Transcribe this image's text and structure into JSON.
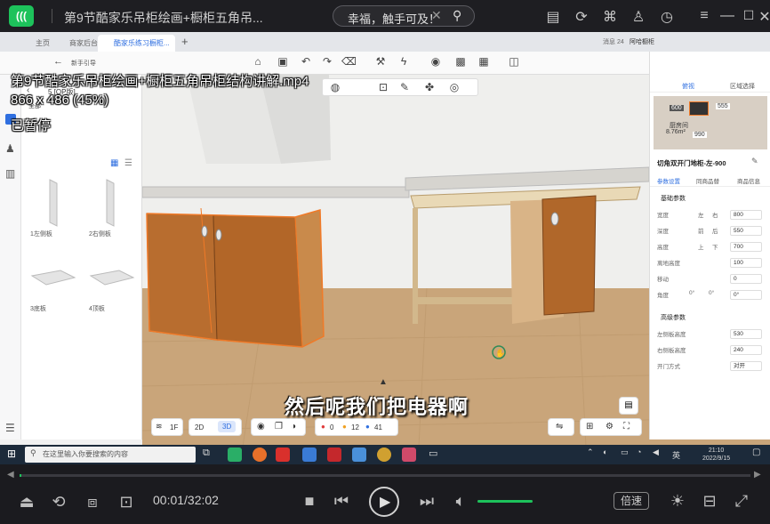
{
  "player": {
    "logo_text": "(((",
    "title": "第9节酷家乐吊柜绘画+橱柜五角吊...",
    "search_text": "幸福，触手可及！",
    "overlay_filename": "第9节酷家乐吊柜绘画+橱柜五角吊柜结构讲解.mp4",
    "overlay_resolution": "866 x 486 (45%)",
    "overlay_status": "已暂停",
    "subtitle": "然后呢我们把电器啊",
    "time": "00:01/32:02",
    "progress": 0.0005,
    "volume": 1.0,
    "speed_label": "倍速"
  },
  "browser": {
    "tabs": [
      {
        "label": "主页"
      },
      {
        "label": "商家后台"
      },
      {
        "label": "酷家乐练习橱柜..."
      }
    ],
    "new_tab": "+"
  },
  "app": {
    "back_label": "新手引导",
    "left_panel": {
      "header": "5 [OP版]",
      "rail_label": "全部",
      "parts": [
        {
          "label": "1左侧板"
        },
        {
          "label": "2右侧板"
        },
        {
          "label": "3底板"
        },
        {
          "label": "4顶板"
        }
      ]
    },
    "floating_toolbar_value": "",
    "bottom_bar": {
      "floor": "1F",
      "view_2d": "2D",
      "view_3d": "3D",
      "error_count": "0",
      "warn_count": "12",
      "info_count": "41"
    },
    "right_panel": {
      "user_msg": "消息 24",
      "user_name": "阿哈橱柜",
      "tabs": [
        "俯视",
        "区域选择"
      ],
      "minimap": {
        "left": "600",
        "right": "555",
        "center": "990",
        "room": "厨房间",
        "area": "8.76m²"
      },
      "object_title": "切角双开门地柜-左-900",
      "prop_tabs": [
        "参数设置",
        "同商品替",
        "商品信息"
      ],
      "section_basic": "基础参数",
      "rows": [
        {
          "label": "宽度",
          "opt1": "左",
          "opt2": "右",
          "value": "800"
        },
        {
          "label": "深度",
          "opt1": "前",
          "opt2": "后",
          "value": "550"
        },
        {
          "label": "高度",
          "opt1": "上",
          "opt2": "下",
          "value": "700"
        },
        {
          "label": "离地高度",
          "opt1": "",
          "opt2": "",
          "value": "100"
        },
        {
          "label": "移动",
          "opt1": "",
          "opt2": "",
          "value": "0"
        },
        {
          "label": "角度",
          "opt1": "0°",
          "opt2": "0°",
          "value": "0°"
        }
      ],
      "section_advanced": "高级参数",
      "adv_rows": [
        {
          "label": "左侧板高度",
          "value": "530"
        },
        {
          "label": "右侧板高度",
          "value": "240"
        },
        {
          "label": "开门方式",
          "value": "对开"
        }
      ]
    }
  },
  "taskbar": {
    "search_placeholder": "在这里输入你要搜索的内容",
    "lang": "英",
    "time": "21:10",
    "date": "2022/9/15"
  },
  "colors": {
    "accent_green": "#1dc25b",
    "cabinet_wood": "#b0672a",
    "selection_orange": "#f07a28",
    "floor_wood": "#c9a57a"
  }
}
